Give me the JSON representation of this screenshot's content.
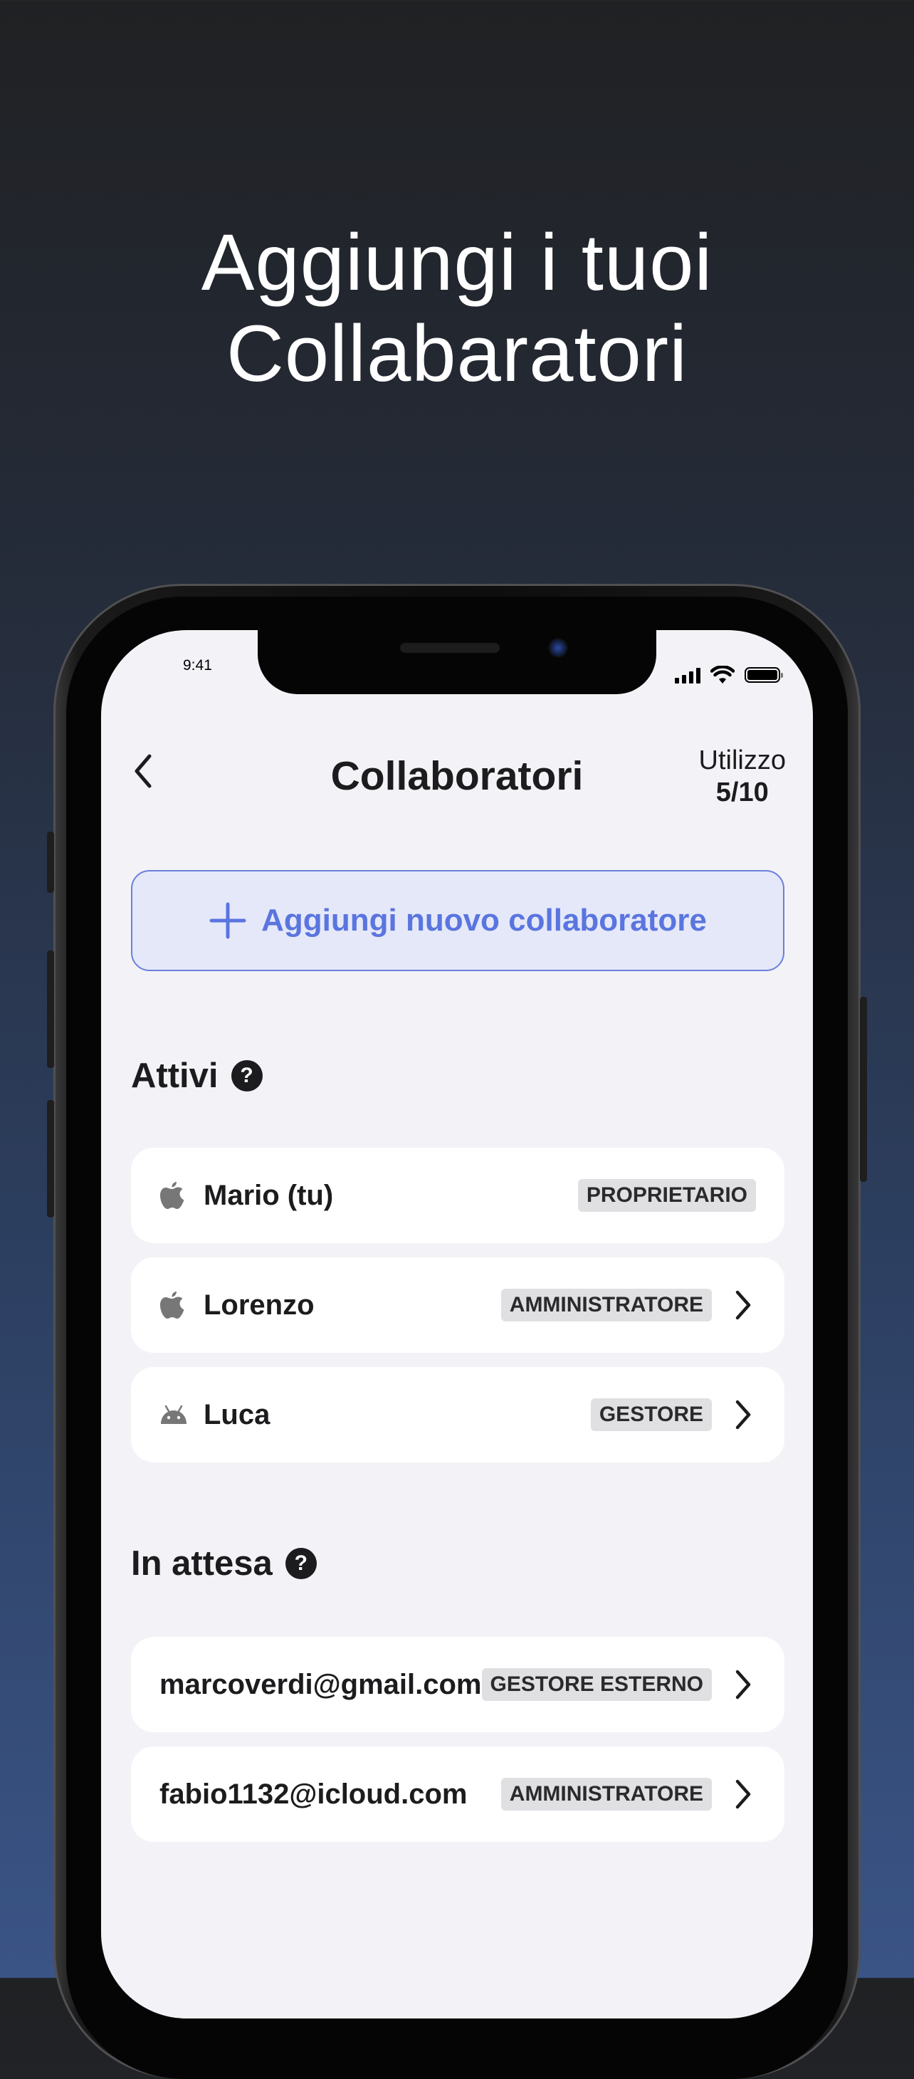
{
  "headline": {
    "line1": "Aggiungi i tuoi",
    "line2": "Collabaratori"
  },
  "status_bar": {
    "time": "9:41"
  },
  "nav": {
    "back_icon": "chevron-left-icon",
    "title": "Collaboratori",
    "usage_label": "Utilizzo",
    "usage_value": "5/10"
  },
  "add_button": {
    "icon": "plus-icon",
    "label": "Aggiungi nuovo collaboratore"
  },
  "active_section": {
    "title": "Attivi",
    "help_icon": "?",
    "items": [
      {
        "platform_icon": "apple-icon",
        "name": "Mario (tu)",
        "role": "PROPRIETARIO",
        "has_chevron": false
      },
      {
        "platform_icon": "apple-icon",
        "name": "Lorenzo",
        "role": "AMMINISTRATORE",
        "has_chevron": true
      },
      {
        "platform_icon": "android-icon",
        "name": "Luca",
        "role": "GESTORE",
        "has_chevron": true
      }
    ]
  },
  "pending_section": {
    "title": "In attesa",
    "help_icon": "?",
    "items": [
      {
        "email": "marcoverdi@gmail.com",
        "role": "GESTORE ESTERNO",
        "has_chevron": true
      },
      {
        "email": "fabio1132@icloud.com",
        "role": "AMMINISTRATORE",
        "has_chevron": true
      }
    ]
  },
  "colors": {
    "accent": "#5a75df",
    "accent_bg": "#e5e8f8",
    "screen_bg": "#f3f3f7",
    "badge_bg": "#e0e0e3",
    "text": "#1c1c1e"
  }
}
